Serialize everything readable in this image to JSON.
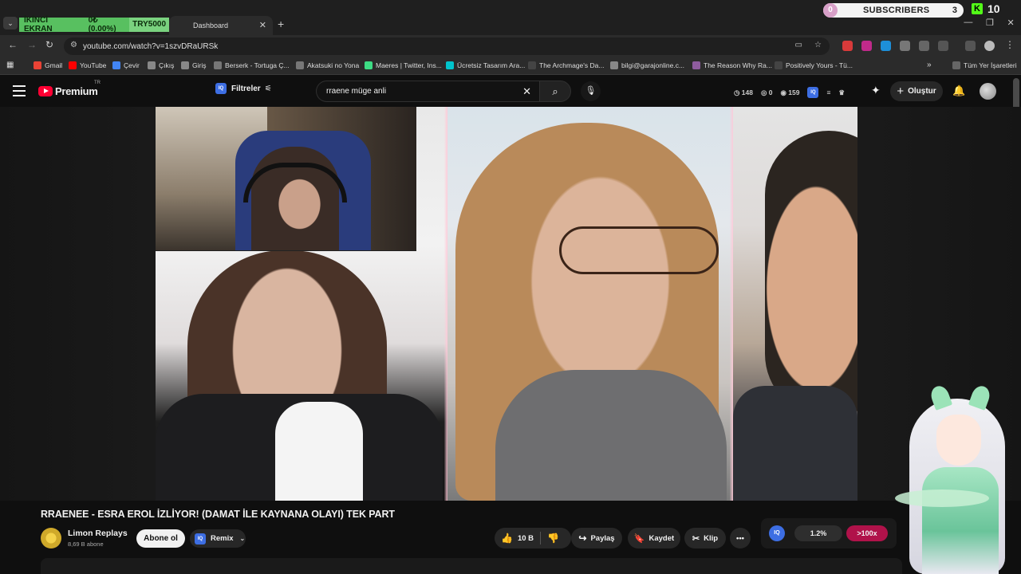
{
  "browser": {
    "overlay": {
      "label": "İKİNCİ EKRAN",
      "value": "0₺ (0.00%)",
      "currency": "TRY5000"
    },
    "active_tab_title": "Dashboard",
    "url": "youtube.com/watch?v=1szvDRaURSk",
    "subscribers": {
      "label": "SUBSCRIBERS",
      "left_count": "0",
      "right_count": "3"
    },
    "kick_count": "10",
    "bookmarks": [
      {
        "label": "Gmail",
        "color": "#ea4335"
      },
      {
        "label": "YouTube",
        "color": "#ff0000"
      },
      {
        "label": "Çevir",
        "color": "#4285f4"
      },
      {
        "label": "Çıkış",
        "color": "#888888"
      },
      {
        "label": "Giriş",
        "color": "#888888"
      },
      {
        "label": "Berserk - Tortuga Ç...",
        "color": "#777777"
      },
      {
        "label": "Akatsuki no Yona",
        "color": "#777777"
      },
      {
        "label": "Maeres | Twitter, Ins...",
        "color": "#3ddc84"
      },
      {
        "label": "Ücretsiz Tasarım Ara...",
        "color": "#00c4cc"
      },
      {
        "label": "The Archmage's Da...",
        "color": "#444444"
      },
      {
        "label": "bilgi@garajonline.c...",
        "color": "#888888"
      },
      {
        "label": "The Reason Why Ra...",
        "color": "#8e5c9e"
      },
      {
        "label": "Positively Yours - Tü...",
        "color": "#444444"
      }
    ],
    "all_bookmarks_label": "Tüm Yer İşaretleri"
  },
  "youtube": {
    "brand": "Premium",
    "country": "TR",
    "filters_label": "Filtreler",
    "search_value": "rraene müge anli",
    "stats": {
      "a": "148",
      "b": "0",
      "c": "159"
    },
    "create_label": "Oluştur"
  },
  "video": {
    "title": "RRAENEE - ESRA EROL İZLİYOR! (DAMAT İLE KAYNANA OLAYI) TEK PART",
    "channel": "Limon Replays",
    "channel_subs": "8,69 B abone",
    "subscribe_label": "Abone ol",
    "remix_label": "Remix",
    "like_count": "10 B",
    "share_label": "Paylaş",
    "save_label": "Kaydet",
    "clip_label": "Klip",
    "iq": {
      "badge": "IQ",
      "percent": "1.2%",
      "multiplier": ">100x"
    }
  }
}
